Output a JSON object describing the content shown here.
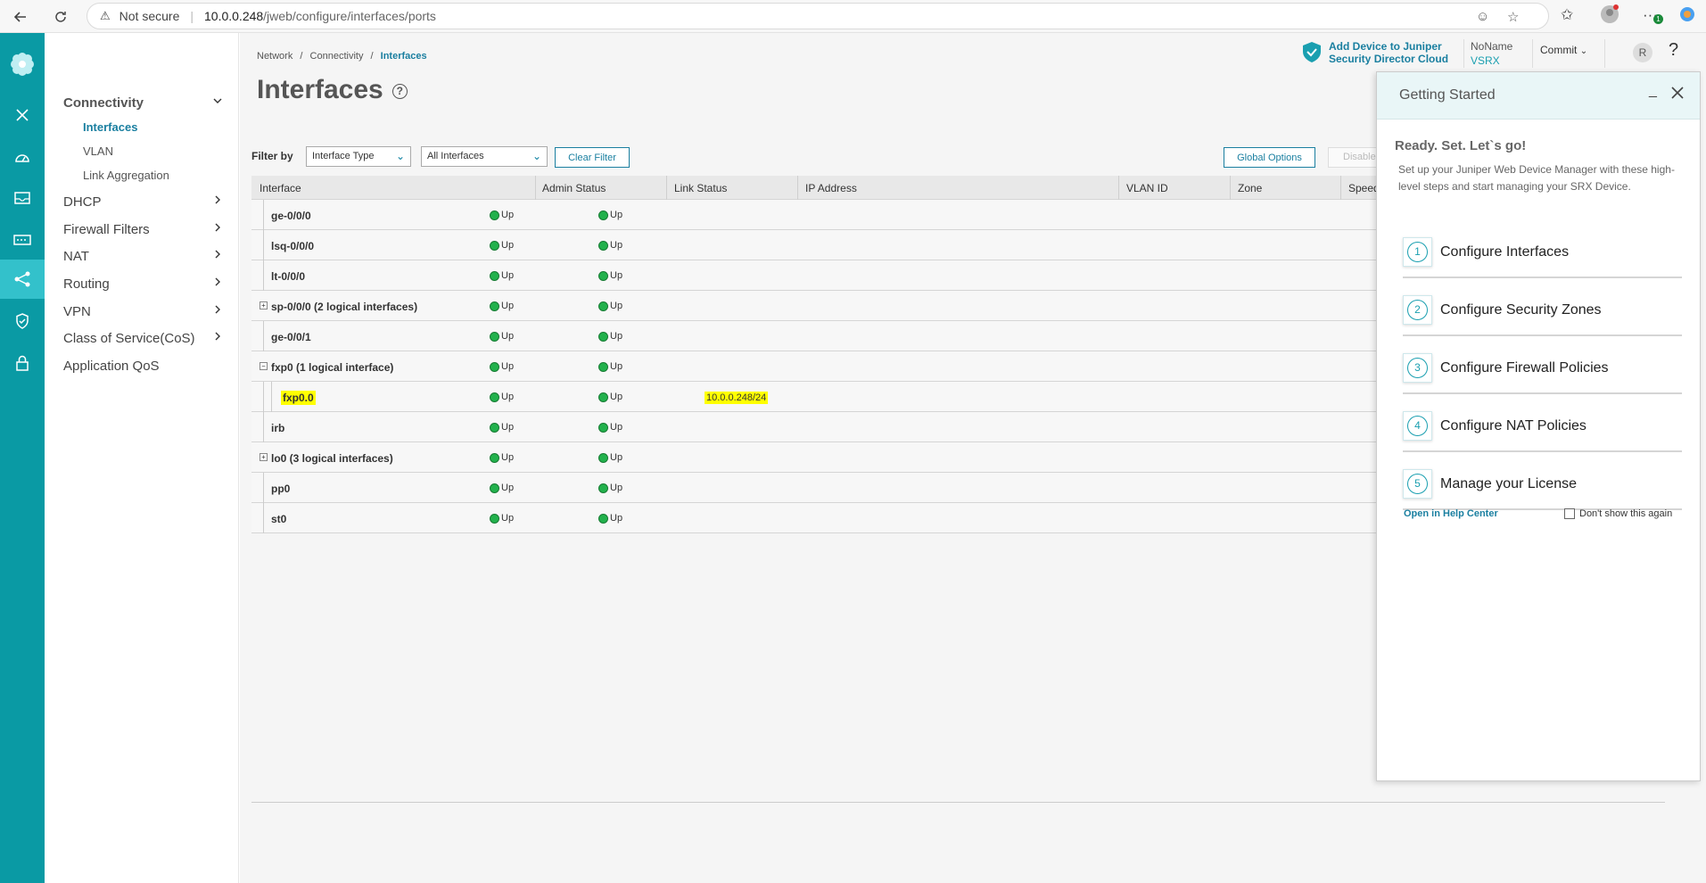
{
  "browser": {
    "security_label": "Not secure",
    "url_host": "10.0.0.248",
    "url_path": "/jweb/configure/interfaces/ports",
    "notification_count": "1"
  },
  "sidebar": {
    "connectivity": {
      "label": "Connectivity",
      "items": [
        {
          "label": "Interfaces",
          "active": true
        },
        {
          "label": "VLAN"
        },
        {
          "label": "Link Aggregation"
        }
      ]
    },
    "sections": [
      {
        "label": "DHCP"
      },
      {
        "label": "Firewall Filters"
      },
      {
        "label": "NAT"
      },
      {
        "label": "Routing"
      },
      {
        "label": "VPN"
      },
      {
        "label": "Class of Service(CoS)"
      },
      {
        "label": "Application QoS"
      }
    ]
  },
  "breadcrumb": {
    "items": [
      "Network",
      "Connectivity",
      "Interfaces"
    ]
  },
  "page": {
    "title": "Interfaces"
  },
  "header": {
    "cloud_line1": "Add Device to Juniper",
    "cloud_line2": "Security Director Cloud",
    "device_name": "NoName",
    "device_model": "VSRX",
    "commit_label": "Commit",
    "avatar_initial": "R",
    "help_label": "?"
  },
  "filters": {
    "label": "Filter by",
    "type_select": "Interface Type",
    "scope_select": "All Interfaces",
    "clear_label": "Clear Filter",
    "global_options_label": "Global Options",
    "disable_label": "Disable"
  },
  "table": {
    "columns": [
      "Interface",
      "Admin Status",
      "Link Status",
      "IP Address",
      "VLAN ID",
      "Zone",
      "Speed"
    ],
    "rows": [
      {
        "name": "ge-0/0/0",
        "admin": "Up",
        "link": "Up",
        "ip": ""
      },
      {
        "name": "lsq-0/0/0",
        "admin": "Up",
        "link": "Up",
        "ip": ""
      },
      {
        "name": "lt-0/0/0",
        "admin": "Up",
        "link": "Up",
        "ip": ""
      },
      {
        "name": "sp-0/0/0 (2 logical interfaces)",
        "admin": "Up",
        "link": "Up",
        "ip": "",
        "expander": "+"
      },
      {
        "name": "ge-0/0/1",
        "admin": "Up",
        "link": "Up",
        "ip": ""
      },
      {
        "name": "fxp0 (1 logical interface)",
        "admin": "Up",
        "link": "Up",
        "ip": "",
        "expander": "−"
      },
      {
        "name": "fxp0.0",
        "admin": "Up",
        "link": "Up",
        "ip": "10.0.0.248/24",
        "child": true,
        "highlight": true
      },
      {
        "name": "irb",
        "admin": "Up",
        "link": "Up",
        "ip": ""
      },
      {
        "name": "lo0 (3 logical interfaces)",
        "admin": "Up",
        "link": "Up",
        "ip": "",
        "expander": "+"
      },
      {
        "name": "pp0",
        "admin": "Up",
        "link": "Up",
        "ip": ""
      },
      {
        "name": "st0",
        "admin": "Up",
        "link": "Up",
        "ip": ""
      }
    ]
  },
  "getting_started": {
    "title": "Getting Started",
    "headline": "Ready. Set. Let`s go!",
    "description": "Set up your Juniper Web Device Manager with these high-level steps and start managing your SRX Device.",
    "steps": [
      {
        "num": "1",
        "label": "Configure Interfaces"
      },
      {
        "num": "2",
        "label": "Configure Security Zones"
      },
      {
        "num": "3",
        "label": "Configure Firewall Policies"
      },
      {
        "num": "4",
        "label": "Configure NAT Policies"
      },
      {
        "num": "5",
        "label": "Manage your License"
      }
    ],
    "help_link": "Open in Help Center",
    "dont_show": "Don't show this again"
  },
  "colors": {
    "rail": "#0a9aa4",
    "accent": "#1a7fa0",
    "status_up": "#22b14c",
    "highlight": "#ffff00"
  }
}
